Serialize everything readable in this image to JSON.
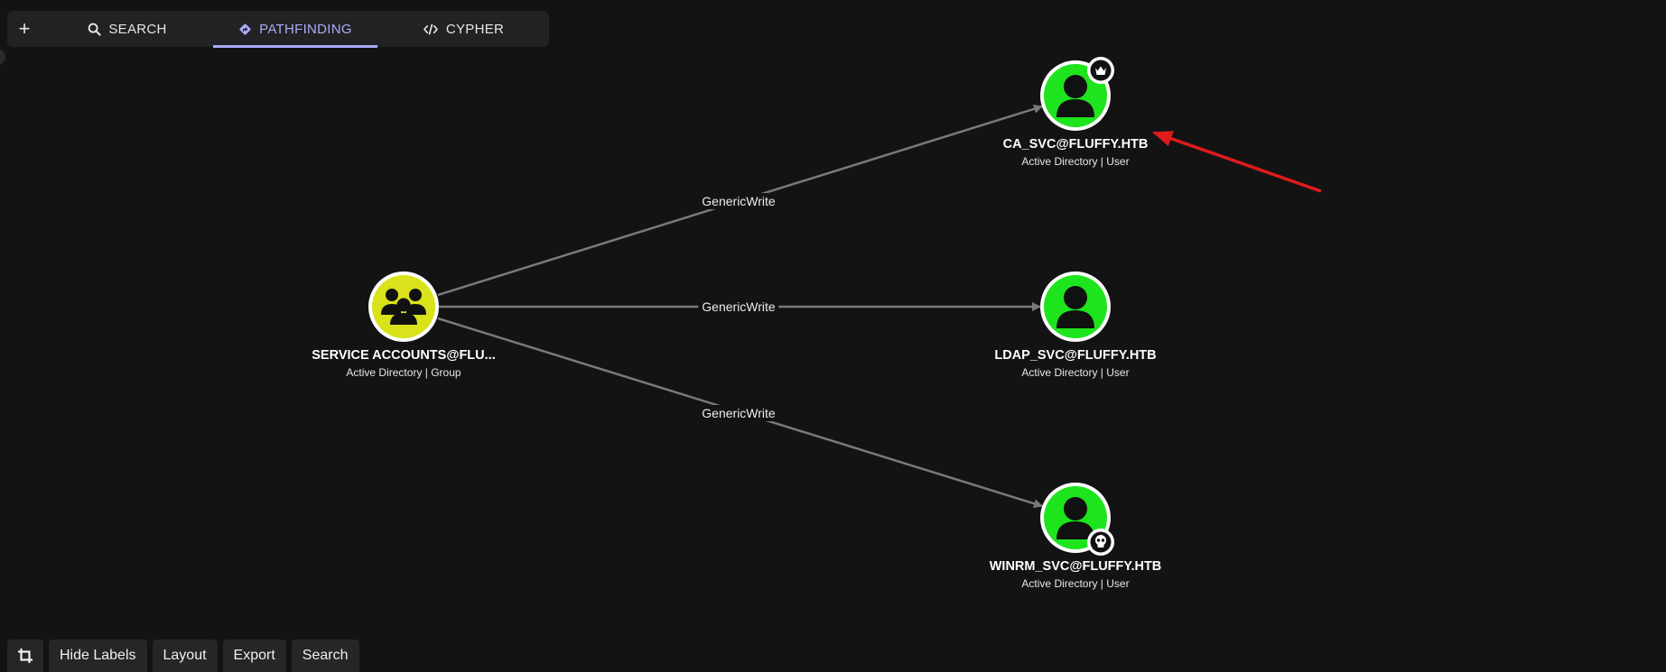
{
  "tabs": {
    "add": "+",
    "search": "SEARCH",
    "pathfinding": "PATHFINDING",
    "cypher": "CYPHER",
    "active": "pathfinding"
  },
  "colors": {
    "background": "#131314",
    "user_node": "#1ee41e",
    "group_node": "#d9e21a",
    "edge": "#7a7a7a",
    "accent": "#a9acf5",
    "annotation_arrow": "#e01b1b"
  },
  "nodes": {
    "group": {
      "name": "SERVICE ACCOUNTS@FLU...",
      "kind": "Active Directory | Group",
      "icon": "users-group-icon"
    },
    "ca_svc": {
      "name": "CA_SVC@FLUFFY.HTB",
      "kind": "Active Directory | User",
      "icon": "user-icon",
      "badge": "crown-icon"
    },
    "ldap_svc": {
      "name": "LDAP_SVC@FLUFFY.HTB",
      "kind": "Active Directory | User",
      "icon": "user-icon"
    },
    "winrm_svc": {
      "name": "WINRM_SVC@FLUFFY.HTB",
      "kind": "Active Directory | User",
      "icon": "user-icon",
      "badge": "skull-icon"
    }
  },
  "edges": {
    "to_ca": "GenericWrite",
    "to_ldap": "GenericWrite",
    "to_winrm": "GenericWrite"
  },
  "bottom_toolbar": {
    "crop_icon": "crop-icon",
    "hide_labels": "Hide Labels",
    "layout": "Layout",
    "export": "Export",
    "search": "Search"
  }
}
